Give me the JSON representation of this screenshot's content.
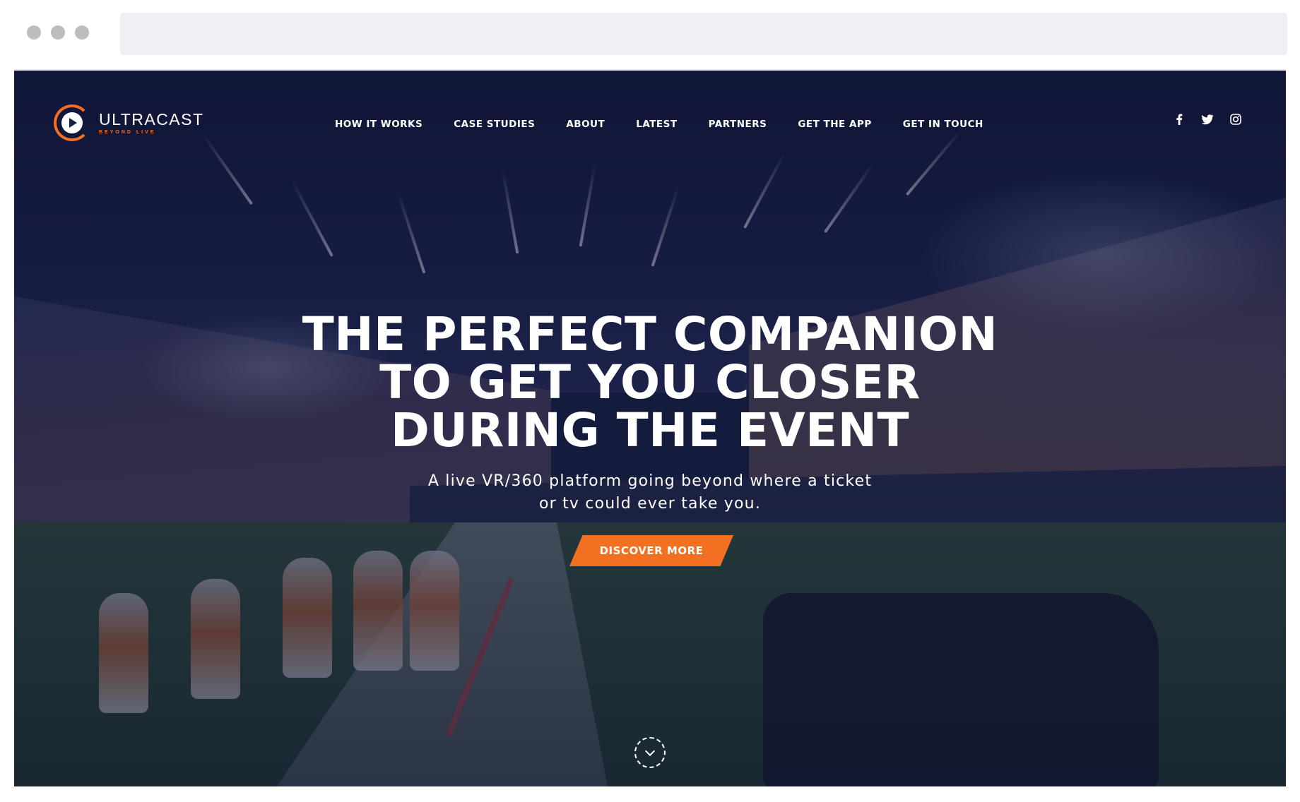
{
  "brand": {
    "name": "ULTRACAST",
    "tagline": "BEYOND LIVE",
    "accent_color": "#f36f21"
  },
  "nav": {
    "items": [
      {
        "label": "HOW IT WORKS"
      },
      {
        "label": "CASE STUDIES"
      },
      {
        "label": "ABOUT"
      },
      {
        "label": "LATEST"
      },
      {
        "label": "PARTNERS"
      },
      {
        "label": "GET THE APP"
      },
      {
        "label": "GET IN TOUCH"
      }
    ]
  },
  "social": [
    "facebook-icon",
    "twitter-icon",
    "instagram-icon"
  ],
  "hero": {
    "headline_lines": [
      "THE PERFECT COMPANION",
      "TO GET YOU CLOSER",
      "DURING THE EVENT"
    ],
    "subheadline_lines": [
      "A live VR/360 platform going beyond where a ticket",
      "or tv could ever take you."
    ],
    "cta_label": "DISCOVER MORE"
  }
}
